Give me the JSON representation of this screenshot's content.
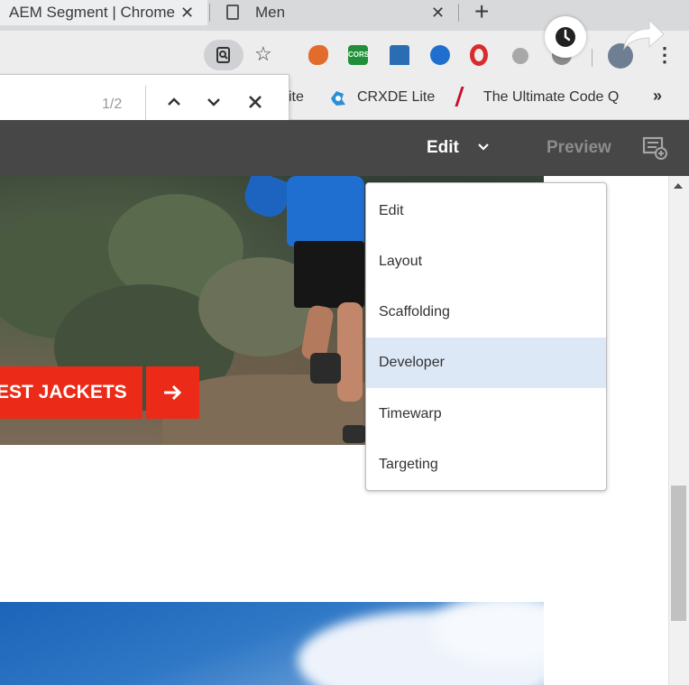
{
  "browser": {
    "tabs": [
      {
        "title": "AEM Segment | Chrome",
        "close": "✕"
      },
      {
        "title": "Men",
        "close": "✕"
      }
    ],
    "new_tab": "+",
    "extensions": [
      {
        "icon": "extension-orange-icon"
      },
      {
        "icon": "cors-icon",
        "label": "CORS"
      },
      {
        "icon": "extension-stamp-icon"
      },
      {
        "icon": "extension-blue-circle-icon"
      },
      {
        "icon": "opera-icon"
      },
      {
        "icon": "extension-grey-icon"
      },
      {
        "icon": "extension-dark-icon"
      }
    ],
    "menu_dots": "⋮",
    "bookmarks": [
      {
        "label": "ite"
      },
      {
        "label": "CRXDE Lite",
        "icon": "crxde-icon"
      },
      {
        "label": "The Ultimate Code Q",
        "icon": "slash-icon"
      }
    ],
    "bookmarks_overflow": "»"
  },
  "find_bar": {
    "count": "1/2"
  },
  "aem_header": {
    "mode": "Edit",
    "preview": "Preview"
  },
  "page": {
    "cta_label": "EST JACKETS"
  },
  "mode_menu": {
    "items": [
      {
        "label": "Edit"
      },
      {
        "label": "Layout"
      },
      {
        "label": "Scaffolding"
      },
      {
        "label": "Developer",
        "highlighted": true
      },
      {
        "label": "Timewarp"
      },
      {
        "label": "Targeting"
      }
    ]
  },
  "colors": {
    "aem_header": "#474747",
    "cta": "#eb2b17",
    "menu_highlight": "#dde8f7",
    "runner_jacket": "#1f6fd1"
  }
}
